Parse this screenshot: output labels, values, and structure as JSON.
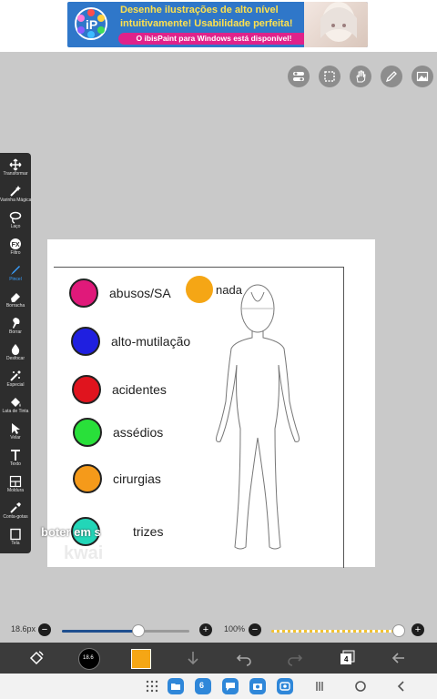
{
  "banner": {
    "line1": "Desenhe ilustrações de alto nível",
    "line2": "intuitivamente! Usabilidade perfeita!",
    "cta": "O ibisPaint para Windows está disponível!"
  },
  "toolbar": {
    "items": [
      {
        "label": "Transformar",
        "icon": "move-icon"
      },
      {
        "label": "Varinha Mágica",
        "icon": "magic-wand-icon"
      },
      {
        "label": "Laço",
        "icon": "lasso-icon"
      },
      {
        "label": "Filtro",
        "icon": "fx-icon"
      },
      {
        "label": "Pincel",
        "icon": "brush-icon"
      },
      {
        "label": "Borracha",
        "icon": "eraser-icon"
      },
      {
        "label": "Borrar",
        "icon": "smudge-icon"
      },
      {
        "label": "Desfocar",
        "icon": "blur-icon"
      },
      {
        "label": "Especial",
        "icon": "special-icon"
      },
      {
        "label": "Lata de Tinta",
        "icon": "bucket-icon"
      },
      {
        "label": "Velar",
        "icon": "cursor-icon"
      },
      {
        "label": "Texto",
        "icon": "text-icon"
      },
      {
        "label": "Moldura",
        "icon": "frame-icon"
      },
      {
        "label": "Conta-gotas",
        "icon": "eyedropper-icon"
      },
      {
        "label": "Tela",
        "icon": "canvas-icon"
      }
    ],
    "active_index": 4
  },
  "legend": {
    "items": [
      {
        "label": "abusos/SA",
        "color": "#e0197a"
      },
      {
        "label": "alto-mutilação",
        "color": "#1f1fe0"
      },
      {
        "label": "acidentes",
        "color": "#e0141e"
      },
      {
        "label": "assédios",
        "color": "#29e03a"
      },
      {
        "label": "cirurgias",
        "color": "#f59a1a"
      },
      {
        "label": "trizes",
        "color": "#22d6b8"
      }
    ],
    "nada": {
      "label": "nada",
      "color": "#f5a615"
    }
  },
  "overlay_text": "boter   em s   ",
  "watermark": "kwai",
  "brush": {
    "size_label": "18.6px",
    "opacity_label": "100%",
    "size_fraction": 0.6,
    "opacity_fraction": 1.0
  },
  "bottom_bar": {
    "brush_size_badge": "18.6",
    "color": "#f5a615",
    "layer_count": "4"
  },
  "nav": {
    "badge": "6"
  }
}
